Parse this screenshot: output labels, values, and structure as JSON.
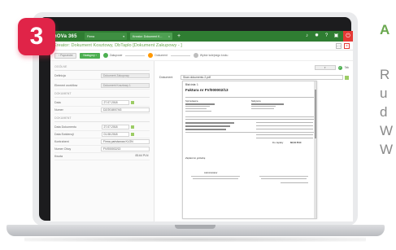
{
  "badge": {
    "number": "3",
    "color": "#e02448"
  },
  "side_text": {
    "heading": "A",
    "lines": [
      "R",
      "u",
      "d",
      "W",
      "W"
    ]
  },
  "app": {
    "brand": "nOVa 365",
    "tabs": [
      {
        "label": "Firma"
      },
      {
        "label": "Kreator: Dokument K..."
      }
    ],
    "add_tab": "+",
    "title": "Kreator: Dokument Kosztowy, DbTaplo [Dokument Zakupowy - ]",
    "accent": "#2f7d32"
  },
  "wizard": {
    "prev_label": "Poprzedni",
    "next_label": "Następny",
    "steps": [
      {
        "label": "Zakupowe",
        "color": "#4caf50"
      },
      {
        "label": "Dokument",
        "color": "#ff9800"
      },
      {
        "label": "Wybór kolejnego kroku",
        "color": "#bdbdbd"
      }
    ]
  },
  "form": {
    "sections": [
      {
        "title": "OGÓLNE",
        "rows": [
          {
            "label": "Definicja",
            "value": "Dokument Zakupowy"
          },
          {
            "label": "Element workflow",
            "value": "Dokument Kosztowy 1"
          }
        ]
      },
      {
        "title": "DOKUMENT",
        "rows": [
          {
            "label": "Data",
            "value": "27.07.2018"
          },
          {
            "label": "Numer",
            "value": "DZ/2018/07/43"
          }
        ]
      },
      {
        "title": "DOKUMENT",
        "rows": [
          {
            "label": "Data Dokumentu",
            "value": "27.07.2018"
          },
          {
            "label": "Data Ewidencji",
            "value": "01.08.2018"
          },
          {
            "label": "Kontrahent",
            "value": "Firma państwowa KLON"
          },
          {
            "label": "Numer Obcy",
            "value": "FV/000002/13"
          },
          {
            "label": "Kwota",
            "value": "83.64 PLN"
          }
        ]
      }
    ]
  },
  "document": {
    "toolbar_check_label": "Tak",
    "field_label": "Dokument",
    "field_value": "Skan dokumentu 2.pdf"
  },
  "preview": {
    "header": "Biał ónia: 1",
    "title": "Faktura nr FV/000002/13",
    "seller_label": "Sprzedawca",
    "buyer_label": "Nabywca",
    "signature_label": "Zapłacono gotówką",
    "signer_label": "Administrator",
    "total_label": "Do zapłaty",
    "total_value": "83,64 PLN"
  }
}
